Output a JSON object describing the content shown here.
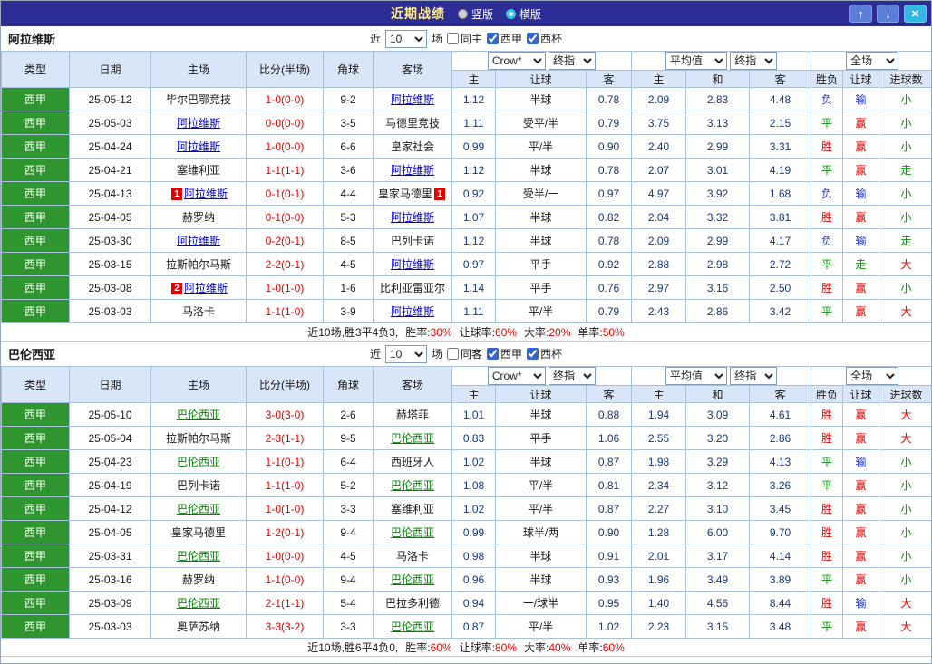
{
  "titlebar": {
    "title": "近期战绩",
    "vertical_label": "竖版",
    "horizontal_label": "横版",
    "up_icon": "↑",
    "down_icon": "↓",
    "close_icon": "×"
  },
  "filter": {
    "near_label": "近",
    "games_count": "10",
    "games_unit": "场",
    "league_label": "西甲",
    "cup_label": "西杯",
    "same_checked": false,
    "league_checked": true,
    "cup_checked": true
  },
  "header": {
    "type": "类型",
    "date": "日期",
    "home": "主场",
    "score": "比分(半场)",
    "corner": "角球",
    "away": "客场",
    "asia_home": "主",
    "asia_line": "让球",
    "asia_away": "客",
    "euro_home": "主",
    "euro_draw": "和",
    "euro_away": "客",
    "result": "胜负",
    "asia_result": "让球",
    "goals": "进球数",
    "bookmaker_select": "Crow*",
    "final_select_1": "终指",
    "average_select": "平均值",
    "final_select_2": "终指",
    "scope_select": "全场"
  },
  "colors": {
    "outcome": {
      "胜": "#e60000",
      "平": "#009900",
      "负": "#2233cc",
      "赢": "#e60000",
      "走": "#009900",
      "输": "#2233cc",
      "大": "#e60000",
      "小": "#009900"
    }
  },
  "sections": [
    {
      "team": "阿拉维斯",
      "accent": "#0000cc",
      "same_filter_label": "同主",
      "rows": [
        {
          "league": "西甲",
          "date": "25-05-12",
          "home": "毕尔巴鄂竞技",
          "home_badge": "",
          "score": "1-0(0-0)",
          "corner": "9-2",
          "away": "阿拉维斯",
          "away_badge": "",
          "focus": "away",
          "asia_home": "1.12",
          "asia_line": "半球",
          "asia_away": "0.78",
          "euro_home": "2.09",
          "euro_draw": "2.83",
          "euro_away": "4.48",
          "result": "负",
          "asia_result": "输",
          "goals": "小"
        },
        {
          "league": "西甲",
          "date": "25-05-03",
          "home": "阿拉维斯",
          "home_badge": "",
          "score": "0-0(0-0)",
          "corner": "3-5",
          "away": "马德里竞技",
          "away_badge": "",
          "focus": "home",
          "asia_home": "1.11",
          "asia_line": "受平/半",
          "asia_away": "0.79",
          "euro_home": "3.75",
          "euro_draw": "3.13",
          "euro_away": "2.15",
          "result": "平",
          "asia_result": "赢",
          "goals": "小"
        },
        {
          "league": "西甲",
          "date": "25-04-24",
          "home": "阿拉维斯",
          "home_badge": "",
          "score": "1-0(0-0)",
          "corner": "6-6",
          "away": "皇家社会",
          "away_badge": "",
          "focus": "home",
          "asia_home": "0.99",
          "asia_line": "平/半",
          "asia_away": "0.90",
          "euro_home": "2.40",
          "euro_draw": "2.99",
          "euro_away": "3.31",
          "result": "胜",
          "asia_result": "赢",
          "goals": "小"
        },
        {
          "league": "西甲",
          "date": "25-04-21",
          "home": "塞维利亚",
          "home_badge": "",
          "score": "1-1(1-1)",
          "corner": "3-6",
          "away": "阿拉维斯",
          "away_badge": "",
          "focus": "away",
          "asia_home": "1.12",
          "asia_line": "半球",
          "asia_away": "0.78",
          "euro_home": "2.07",
          "euro_draw": "3.01",
          "euro_away": "4.19",
          "result": "平",
          "asia_result": "赢",
          "goals": "走"
        },
        {
          "league": "西甲",
          "date": "25-04-13",
          "home": "阿拉维斯",
          "home_badge": "1",
          "score": "0-1(0-1)",
          "corner": "4-4",
          "away": "皇家马德里",
          "away_badge": "1",
          "focus": "home",
          "asia_home": "0.92",
          "asia_line": "受半/一",
          "asia_away": "0.97",
          "euro_home": "4.97",
          "euro_draw": "3.92",
          "euro_away": "1.68",
          "result": "负",
          "asia_result": "输",
          "goals": "小"
        },
        {
          "league": "西甲",
          "date": "25-04-05",
          "home": "赫罗纳",
          "home_badge": "",
          "score": "0-1(0-0)",
          "corner": "5-3",
          "away": "阿拉维斯",
          "away_badge": "",
          "focus": "away",
          "asia_home": "1.07",
          "asia_line": "半球",
          "asia_away": "0.82",
          "euro_home": "2.04",
          "euro_draw": "3.32",
          "euro_away": "3.81",
          "result": "胜",
          "asia_result": "赢",
          "goals": "小"
        },
        {
          "league": "西甲",
          "date": "25-03-30",
          "home": "阿拉维斯",
          "home_badge": "",
          "score": "0-2(0-1)",
          "corner": "8-5",
          "away": "巴列卡诺",
          "away_badge": "",
          "focus": "home",
          "asia_home": "1.12",
          "asia_line": "半球",
          "asia_away": "0.78",
          "euro_home": "2.09",
          "euro_draw": "2.99",
          "euro_away": "4.17",
          "result": "负",
          "asia_result": "输",
          "goals": "走"
        },
        {
          "league": "西甲",
          "date": "25-03-15",
          "home": "拉斯帕尔马斯",
          "home_badge": "",
          "score": "2-2(0-1)",
          "corner": "4-5",
          "away": "阿拉维斯",
          "away_badge": "",
          "focus": "away",
          "asia_home": "0.97",
          "asia_line": "平手",
          "asia_away": "0.92",
          "euro_home": "2.88",
          "euro_draw": "2.98",
          "euro_away": "2.72",
          "result": "平",
          "asia_result": "走",
          "goals": "大"
        },
        {
          "league": "西甲",
          "date": "25-03-08",
          "home": "阿拉维斯",
          "home_badge": "2",
          "score": "1-0(1-0)",
          "corner": "1-6",
          "away": "比利亚雷亚尔",
          "away_badge": "",
          "focus": "home",
          "asia_home": "1.14",
          "asia_line": "平手",
          "asia_away": "0.76",
          "euro_home": "2.97",
          "euro_draw": "3.16",
          "euro_away": "2.50",
          "result": "胜",
          "asia_result": "赢",
          "goals": "小"
        },
        {
          "league": "西甲",
          "date": "25-03-03",
          "home": "马洛卡",
          "home_badge": "",
          "score": "1-1(1-0)",
          "corner": "3-9",
          "away": "阿拉维斯",
          "away_badge": "",
          "focus": "away",
          "asia_home": "1.11",
          "asia_line": "平/半",
          "asia_away": "0.79",
          "euro_home": "2.43",
          "euro_draw": "2.86",
          "euro_away": "3.42",
          "result": "平",
          "asia_result": "赢",
          "goals": "大"
        }
      ],
      "summary": {
        "prefix": "近10场,胜3平4负3,",
        "stats": [
          {
            "label": "胜率:",
            "value": "30%"
          },
          {
            "label": "让球率:",
            "value": "60%"
          },
          {
            "label": "大率:",
            "value": "20%"
          },
          {
            "label": "单率:",
            "value": "50%"
          }
        ]
      }
    },
    {
      "team": "巴伦西亚",
      "accent": "#008800",
      "same_filter_label": "同客",
      "rows": [
        {
          "league": "西甲",
          "date": "25-05-10",
          "home": "巴伦西亚",
          "home_badge": "",
          "score": "3-0(3-0)",
          "corner": "2-6",
          "away": "赫塔菲",
          "away_badge": "",
          "focus": "home",
          "asia_home": "1.01",
          "asia_line": "半球",
          "asia_away": "0.88",
          "euro_home": "1.94",
          "euro_draw": "3.09",
          "euro_away": "4.61",
          "result": "胜",
          "asia_result": "赢",
          "goals": "大"
        },
        {
          "league": "西甲",
          "date": "25-05-04",
          "home": "拉斯帕尔马斯",
          "home_badge": "",
          "score": "2-3(1-1)",
          "corner": "9-5",
          "away": "巴伦西亚",
          "away_badge": "",
          "focus": "away",
          "asia_home": "0.83",
          "asia_line": "平手",
          "asia_away": "1.06",
          "euro_home": "2.55",
          "euro_draw": "3.20",
          "euro_away": "2.86",
          "result": "胜",
          "asia_result": "赢",
          "goals": "大"
        },
        {
          "league": "西甲",
          "date": "25-04-23",
          "home": "巴伦西亚",
          "home_badge": "",
          "score": "1-1(0-1)",
          "corner": "6-4",
          "away": "西班牙人",
          "away_badge": "",
          "focus": "home",
          "asia_home": "1.02",
          "asia_line": "半球",
          "asia_away": "0.87",
          "euro_home": "1.98",
          "euro_draw": "3.29",
          "euro_away": "4.13",
          "result": "平",
          "asia_result": "输",
          "goals": "小"
        },
        {
          "league": "西甲",
          "date": "25-04-19",
          "home": "巴列卡诺",
          "home_badge": "",
          "score": "1-1(1-0)",
          "corner": "5-2",
          "away": "巴伦西亚",
          "away_badge": "",
          "focus": "away",
          "asia_home": "1.08",
          "asia_line": "平/半",
          "asia_away": "0.81",
          "euro_home": "2.34",
          "euro_draw": "3.12",
          "euro_away": "3.26",
          "result": "平",
          "asia_result": "赢",
          "goals": "小"
        },
        {
          "league": "西甲",
          "date": "25-04-12",
          "home": "巴伦西亚",
          "home_badge": "",
          "score": "1-0(1-0)",
          "corner": "3-3",
          "away": "塞维利亚",
          "away_badge": "",
          "focus": "home",
          "asia_home": "1.02",
          "asia_line": "平/半",
          "asia_away": "0.87",
          "euro_home": "2.27",
          "euro_draw": "3.10",
          "euro_away": "3.45",
          "result": "胜",
          "asia_result": "赢",
          "goals": "小"
        },
        {
          "league": "西甲",
          "date": "25-04-05",
          "home": "皇家马德里",
          "home_badge": "",
          "score": "1-2(0-1)",
          "corner": "9-4",
          "away": "巴伦西亚",
          "away_badge": "",
          "focus": "away",
          "asia_home": "0.99",
          "asia_line": "球半/两",
          "asia_away": "0.90",
          "euro_home": "1.28",
          "euro_draw": "6.00",
          "euro_away": "9.70",
          "result": "胜",
          "asia_result": "赢",
          "goals": "小"
        },
        {
          "league": "西甲",
          "date": "25-03-31",
          "home": "巴伦西亚",
          "home_badge": "",
          "score": "1-0(0-0)",
          "corner": "4-5",
          "away": "马洛卡",
          "away_badge": "",
          "focus": "home",
          "asia_home": "0.98",
          "asia_line": "半球",
          "asia_away": "0.91",
          "euro_home": "2.01",
          "euro_draw": "3.17",
          "euro_away": "4.14",
          "result": "胜",
          "asia_result": "赢",
          "goals": "小"
        },
        {
          "league": "西甲",
          "date": "25-03-16",
          "home": "赫罗纳",
          "home_badge": "",
          "score": "1-1(0-0)",
          "corner": "9-4",
          "away": "巴伦西亚",
          "away_badge": "",
          "focus": "away",
          "asia_home": "0.96",
          "asia_line": "半球",
          "asia_away": "0.93",
          "euro_home": "1.96",
          "euro_draw": "3.49",
          "euro_away": "3.89",
          "result": "平",
          "asia_result": "赢",
          "goals": "小"
        },
        {
          "league": "西甲",
          "date": "25-03-09",
          "home": "巴伦西亚",
          "home_badge": "",
          "score": "2-1(1-1)",
          "corner": "5-4",
          "away": "巴拉多利德",
          "away_badge": "",
          "focus": "home",
          "asia_home": "0.94",
          "asia_line": "一/球半",
          "asia_away": "0.95",
          "euro_home": "1.40",
          "euro_draw": "4.56",
          "euro_away": "8.44",
          "result": "胜",
          "asia_result": "输",
          "goals": "大"
        },
        {
          "league": "西甲",
          "date": "25-03-03",
          "home": "奥萨苏纳",
          "home_badge": "",
          "score": "3-3(3-2)",
          "corner": "3-3",
          "away": "巴伦西亚",
          "away_badge": "",
          "focus": "away",
          "asia_home": "0.87",
          "asia_line": "平/半",
          "asia_away": "1.02",
          "euro_home": "2.23",
          "euro_draw": "3.15",
          "euro_away": "3.48",
          "result": "平",
          "asia_result": "赢",
          "goals": "大"
        }
      ],
      "summary": {
        "prefix": "近10场,胜6平4负0,",
        "stats": [
          {
            "label": "胜率:",
            "value": "60%"
          },
          {
            "label": "让球率:",
            "value": "80%"
          },
          {
            "label": "大率:",
            "value": "40%"
          },
          {
            "label": "单率:",
            "value": "60%"
          }
        ]
      }
    }
  ]
}
